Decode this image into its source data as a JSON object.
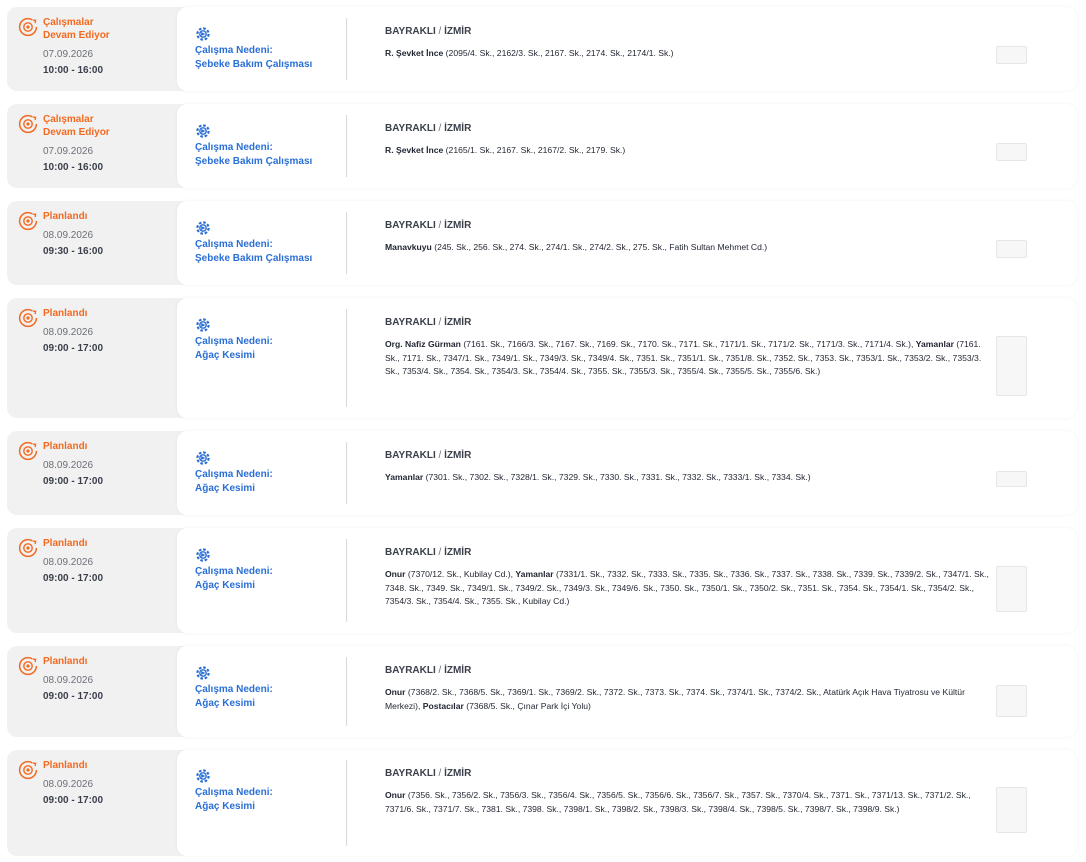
{
  "colors": {
    "status": "#f26a21",
    "reason": "#2a6fd6",
    "card_bg": "#f1f1f1"
  },
  "icons": {
    "status": "gear-sync-icon",
    "reason": "repair-gear-icon"
  },
  "items": [
    {
      "status": "Çalışmalar Devam Ediyor",
      "date": "07.09.2026",
      "time": "10:00 - 16:00",
      "reason_label": "Çalışma Nedeni:",
      "reason": "Şebeke Bakım Çalışması",
      "district": "BAYRAKLI",
      "city": "İZMİR",
      "areas": [
        {
          "name": "R. Şevket İnce",
          "streets": "(2095/4. Sk., 2162/3. Sk., 2167. Sk., 2174. Sk., 2174/1. Sk.)"
        }
      ]
    },
    {
      "status": "Çalışmalar Devam Ediyor",
      "date": "07.09.2026",
      "time": "10:00 - 16:00",
      "reason_label": "Çalışma Nedeni:",
      "reason": "Şebeke Bakım Çalışması",
      "district": "BAYRAKLI",
      "city": "İZMİR",
      "areas": [
        {
          "name": "R. Şevket İnce",
          "streets": "(2165/1. Sk., 2167. Sk., 2167/2. Sk., 2179. Sk.)"
        }
      ]
    },
    {
      "status": "Planlandı",
      "date": "08.09.2026",
      "time": "09:30 - 16:00",
      "reason_label": "Çalışma Nedeni:",
      "reason": "Şebeke Bakım Çalışması",
      "district": "BAYRAKLI",
      "city": "İZMİR",
      "areas": [
        {
          "name": "Manavkuyu",
          "streets": "(245. Sk., 256. Sk., 274. Sk., 274/1. Sk., 274/2. Sk., 275. Sk., Fatih Sultan Mehmet Cd.)"
        }
      ]
    },
    {
      "status": "Planlandı",
      "date": "08.09.2026",
      "time": "09:00 - 17:00",
      "reason_label": "Çalışma Nedeni:",
      "reason": "Ağaç Kesimi",
      "district": "BAYRAKLI",
      "city": "İZMİR",
      "areas": [
        {
          "name": "Org. Nafiz Gürman",
          "streets": "(7161. Sk., 7166/3. Sk., 7167. Sk., 7169. Sk., 7170. Sk., 7171. Sk., 7171/1. Sk., 7171/2. Sk., 7171/3. Sk., 7171/4. Sk.),"
        },
        {
          "name": "Yamanlar",
          "streets": "(7161. Sk., 7171. Sk., 7347/1. Sk., 7349/1. Sk., 7349/3. Sk., 7349/4. Sk., 7351. Sk., 7351/1. Sk., 7351/8. Sk., 7352. Sk., 7353. Sk., 7353/1. Sk., 7353/2. Sk., 7353/3. Sk., 7353/4. Sk., 7354. Sk., 7354/3. Sk., 7354/4. Sk., 7355. Sk., 7355/3. Sk., 7355/4. Sk., 7355/5. Sk., 7355/6. Sk.)"
        }
      ]
    },
    {
      "status": "Planlandı",
      "date": "08.09.2026",
      "time": "09:00 - 17:00",
      "reason_label": "Çalışma Nedeni:",
      "reason": "Ağaç Kesimi",
      "district": "BAYRAKLI",
      "city": "İZMİR",
      "areas": [
        {
          "name": "Yamanlar",
          "streets": "(7301. Sk., 7302. Sk., 7328/1. Sk., 7329. Sk., 7330. Sk., 7331. Sk., 7332. Sk., 7333/1. Sk., 7334. Sk.)"
        }
      ]
    },
    {
      "status": "Planlandı",
      "date": "08.09.2026",
      "time": "09:00 - 17:00",
      "reason_label": "Çalışma Nedeni:",
      "reason": "Ağaç Kesimi",
      "district": "BAYRAKLI",
      "city": "İZMİR",
      "areas": [
        {
          "name": "Onur",
          "streets": "(7370/12. Sk., Kubilay Cd.),"
        },
        {
          "name": "Yamanlar",
          "streets": "(7331/1. Sk., 7332. Sk., 7333. Sk., 7335. Sk., 7336. Sk., 7337. Sk., 7338. Sk., 7339. Sk., 7339/2. Sk., 7347/1. Sk., 7348. Sk., 7349. Sk., 7349/1. Sk., 7349/2. Sk., 7349/3. Sk., 7349/6. Sk., 7350. Sk., 7350/1. Sk., 7350/2. Sk., 7351. Sk., 7354. Sk., 7354/1. Sk., 7354/2. Sk., 7354/3. Sk., 7354/4. Sk., 7355. Sk., Kubilay Cd.)"
        }
      ]
    },
    {
      "status": "Planlandı",
      "date": "08.09.2026",
      "time": "09:00 - 17:00",
      "reason_label": "Çalışma Nedeni:",
      "reason": "Ağaç Kesimi",
      "district": "BAYRAKLI",
      "city": "İZMİR",
      "areas": [
        {
          "name": "Onur",
          "streets": "(7368/2. Sk., 7368/5. Sk., 7369/1. Sk., 7369/2. Sk., 7372. Sk., 7373. Sk., 7374. Sk., 7374/1. Sk., 7374/2. Sk., Atatürk Açık Hava Tiyatrosu ve Kültür Merkezi),"
        },
        {
          "name": "Postacılar",
          "streets": "(7368/5. Sk., Çınar Park İçi Yolu)"
        }
      ]
    },
    {
      "status": "Planlandı",
      "date": "08.09.2026",
      "time": "09:00 - 17:00",
      "reason_label": "Çalışma Nedeni:",
      "reason": "Ağaç Kesimi",
      "district": "BAYRAKLI",
      "city": "İZMİR",
      "areas": [
        {
          "name": "Onur",
          "streets": "(7356. Sk., 7356/2. Sk., 7356/3. Sk., 7356/4. Sk., 7356/5. Sk., 7356/6. Sk., 7356/7. Sk., 7357. Sk., 7370/4. Sk., 7371. Sk., 7371/13. Sk., 7371/2. Sk., 7371/6. Sk., 7371/7. Sk., 7381. Sk., 7398. Sk., 7398/1. Sk., 7398/2. Sk., 7398/3. Sk., 7398/4. Sk., 7398/5. Sk., 7398/7. Sk., 7398/9. Sk.)"
        }
      ]
    }
  ]
}
